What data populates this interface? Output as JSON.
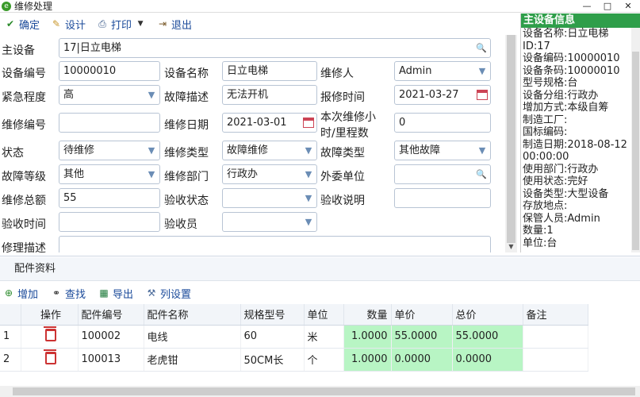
{
  "window": {
    "title": "维修处理",
    "minimize": "—",
    "maximize": "□",
    "close": "✕"
  },
  "toolbar": {
    "confirm": "确定",
    "design": "设计",
    "print": "打印",
    "exit": "退出"
  },
  "form": {
    "main_device_label": "主设备",
    "main_device_value": "17|日立电梯",
    "device_no_label": "设备编号",
    "device_no_value": "10000010",
    "device_name_label": "设备名称",
    "device_name_value": "日立电梯",
    "repairer_label": "维修人",
    "repairer_value": "Admin",
    "urgency_label": "紧急程度",
    "urgency_value": "高",
    "fault_desc_label": "故障描述",
    "fault_desc_value": "无法开机",
    "report_time_label": "报修时间",
    "report_time_value": "2021-03-27",
    "repair_no_label": "维修编号",
    "repair_no_value": "",
    "repair_date_label": "维修日期",
    "repair_date_value": "2021-03-01",
    "hours_label_1": "本次维修小",
    "hours_label_2": "时/里程数",
    "hours_value": "0",
    "status_label": "状态",
    "status_value": "待维修",
    "repair_type_label": "维修类型",
    "repair_type_value": "故障维修",
    "fault_type_label": "故障类型",
    "fault_type_value": "其他故障",
    "fault_level_label": "故障等级",
    "fault_level_value": "其他",
    "repair_dept_label": "维修部门",
    "repair_dept_value": "行政办",
    "outsource_label": "外委单位",
    "outsource_value": "",
    "total_label": "维修总额",
    "total_value": "55",
    "accept_status_label": "验收状态",
    "accept_status_value": "",
    "accept_note_label": "验收说明",
    "accept_note_value": "",
    "accept_time_label": "验收时间",
    "accept_time_value": "",
    "acceptor_label": "验收员",
    "acceptor_value": "",
    "repair_desc_label": "修理描述",
    "repair_desc_value": ""
  },
  "side": {
    "title": "主设备信息",
    "lines": [
      "设备名称:日立电梯",
      "ID:17",
      "设备编码:10000010",
      "设备条码:10000010",
      "型号规格:台",
      "设备分组:行政办",
      "增加方式:本级自筹",
      "制造工厂:",
      "国标编码:",
      "制造日期:2018-08-12",
      "00:00:00",
      "使用部门:行政办",
      "使用状态:完好",
      "设备类型:大型设备",
      "存放地点:",
      "保管人员:Admin",
      "数量:1",
      "单位:台"
    ]
  },
  "parts": {
    "title": "配件资料",
    "toolbar": {
      "add": "增加",
      "find": "查找",
      "export": "导出",
      "columns": "列设置"
    },
    "columns": [
      "",
      "操作",
      "配件编号",
      "配件名称",
      "规格型号",
      "单位",
      "数量",
      "单价",
      "总价",
      "备注"
    ],
    "rows": [
      {
        "idx": "1",
        "code": "100002",
        "name": "电线",
        "spec": "60",
        "unit": "米",
        "qty": "1.0000",
        "price": "55.0000",
        "total": "55.0000",
        "note": ""
      },
      {
        "idx": "2",
        "code": "100013",
        "name": "老虎钳",
        "spec": "50CM长",
        "unit": "个",
        "qty": "1.0000",
        "price": "0.0000",
        "total": "0.0000",
        "note": ""
      }
    ]
  },
  "colors": {
    "side_header": "#2f9e4a",
    "highlight_cell": "#b8f5c4",
    "link": "#1a4a9a"
  },
  "icons": {
    "confirm": "check-icon",
    "design": "edit-icon",
    "print": "printer-icon",
    "exit": "exit-icon",
    "add": "plus-circle-icon",
    "find": "binoculars-icon",
    "export": "excel-icon",
    "columns": "wrench-icon",
    "delete": "trash-icon"
  }
}
